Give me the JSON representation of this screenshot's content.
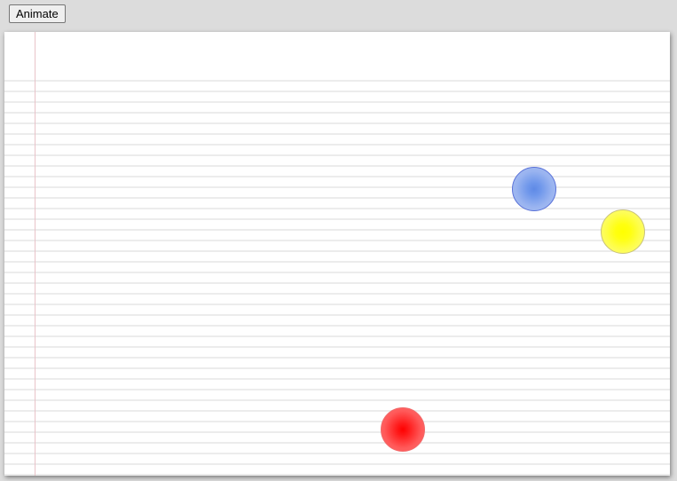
{
  "toolbar": {
    "animate_label": "Animate"
  },
  "balls": [
    {
      "color": "#6f97eb"
    },
    {
      "color": "#ffff00"
    },
    {
      "color": "#ff1a1a"
    }
  ]
}
